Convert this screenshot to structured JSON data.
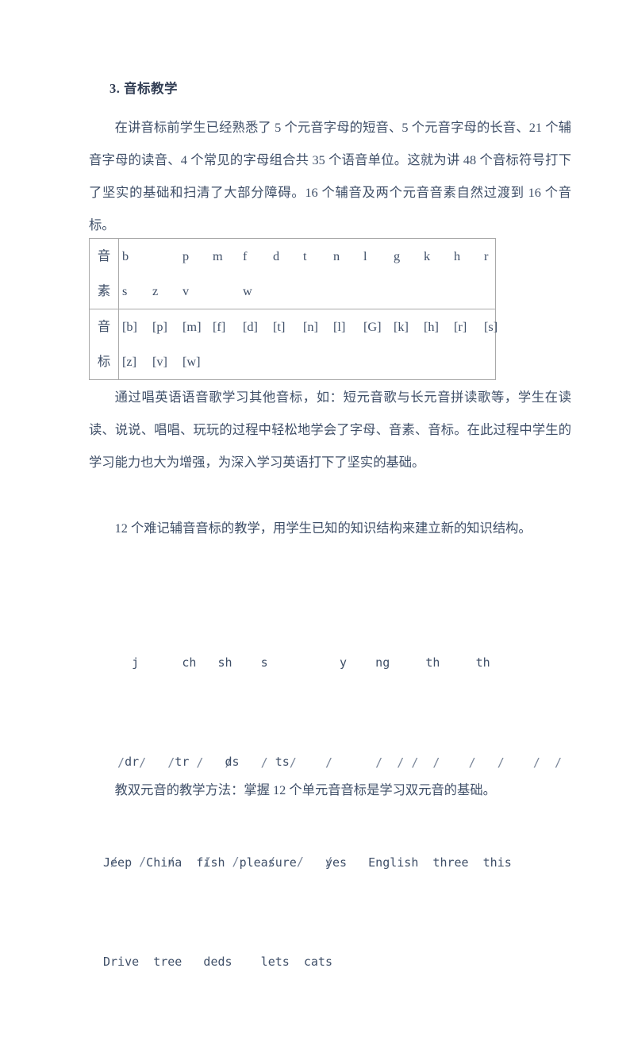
{
  "document": {
    "heading": "3. 音标教学",
    "paragraph_1": "在讲音标前学生已经熟悉了 5 个元音字母的短音、5 个元音字母的长音、21 个辅音字母的读音、4 个常见的字母组合共 35 个语音单位。这就为讲 48 个音标符号打下了坚实的基础和扫清了大部分障碍。16 个辅音及两个元音音素自然过渡到 16 个音标。",
    "paragraph_2": "通过唱英语语音歌学习其他音标，如：短元音歌与长元音拼读歌等，学生在读读、说说、唱唱、玩玩的过程中轻松地学会了字母、音素、音标。在此过程中学生的学习能力也大为增强，为深入学习英语打下了坚实的基础。",
    "paragraph_3": "12 个难记辅音音标的教学，用学生已知的知识结构来建立新的知识结构。",
    "paragraph_4": "教双元音的教学方法：掌握 12 个单元音音标是学习双元音的基础。"
  },
  "phoneme_table": {
    "rows": [
      {
        "label_line_1": "音",
        "label_line_2": "素",
        "data_line_1": [
          "b",
          "",
          "p",
          "m",
          "f",
          "d",
          "t",
          "n",
          "l",
          "g",
          "k",
          "h",
          "r"
        ],
        "data_line_2": [
          "s",
          "z",
          "v",
          "",
          "w"
        ]
      },
      {
        "label_line_1": "音",
        "label_line_2": "标",
        "data_line_1": [
          "[b]",
          "[p]",
          "[m]",
          "[f]",
          "[d]",
          "[t]",
          "[n]",
          "[l]",
          "[G]",
          "[k]",
          "[h]",
          "[r]",
          "[s]"
        ],
        "data_line_2": [
          "[z]",
          "[v]",
          "[w]"
        ]
      }
    ]
  },
  "phonics_examples": {
    "group_1": {
      "letters_row": "    j      ch   sh    s          y    ng     th     th",
      "slash_row": "  /  /   /   /   /    /   /    /      /  / /  /    /   /    /  /",
      "words_row": "Jeep  China  fish  pleasure    yes   English  three  this"
    },
    "group_2": {
      "letters_row": "   dr     tr     ds     ts",
      "slash_row": " /   /   /    /   /    /   /   /",
      "words_row": "Drive  tree   deds    lets  cats"
    }
  }
}
